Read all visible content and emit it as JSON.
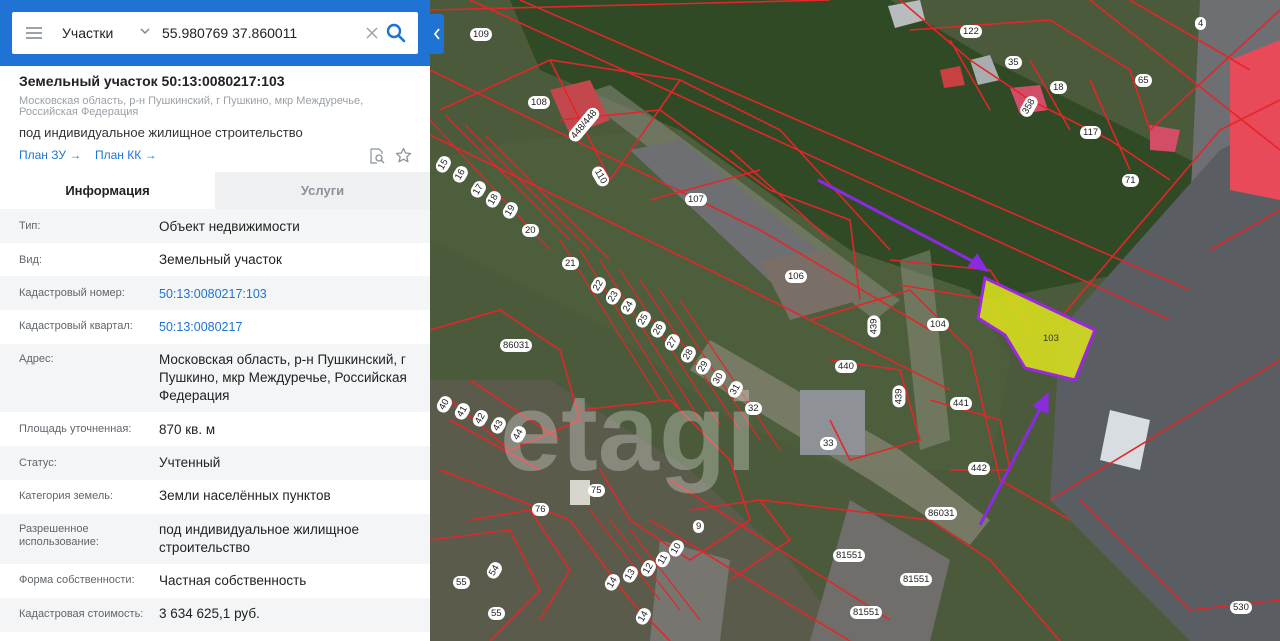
{
  "search": {
    "layer_label": "Участки",
    "query": "55.980769 37.860011"
  },
  "parcel": {
    "title": "Земельный участок 50:13:0080217:103",
    "address": "Московская область, р-н Пушкинский, г Пушкино, мкр Междуречье, Российская Федерация",
    "use": "под индивидуальное жилищное строительство",
    "plan_zu": "План ЗУ →",
    "plan_kk": "План КК →"
  },
  "tabs": {
    "info": "Информация",
    "services": "Услуги"
  },
  "info": [
    {
      "key": "Тип:",
      "value": "Объект недвижимости"
    },
    {
      "key": "Вид:",
      "value": "Земельный участок"
    },
    {
      "key": "Кадастровый номер:",
      "value": "50:13:0080217:103"
    },
    {
      "key": "Кадастровый квартал:",
      "value": "50:13:0080217"
    },
    {
      "key": "Адрес:",
      "value": "Московская область, р-н Пушкинский, г Пушкино, мкр Междуречье, Российская Федерация"
    },
    {
      "key": "Площадь уточненная:",
      "value": "870 кв. м"
    },
    {
      "key": "Статус:",
      "value": "Учтенный"
    },
    {
      "key": "Категория земель:",
      "value": "Земли населённых пунктов"
    },
    {
      "key": "Разрешенное использование:",
      "value": "под индивидуальное жилищное строительство"
    },
    {
      "key": "Форма собственности:",
      "value": "Частная собственность"
    },
    {
      "key": "Кадастровая стоимость:",
      "value": "3 634 625,1 руб."
    }
  ],
  "map": {
    "watermark": "etagi",
    "highlight_label": "103",
    "labels": {
      "l109": "109",
      "l108": "108",
      "l448": "448/448",
      "l110": "110",
      "l107": "107",
      "l106": "106",
      "l122": "122",
      "l35": "35",
      "l18": "18",
      "l358": "358",
      "l65": "65",
      "l117": "117",
      "l71": "71",
      "l4": "4",
      "l15": "15",
      "l16": "16",
      "l17": "17",
      "l18b": "18",
      "l19": "19",
      "l20": "20",
      "l21": "21",
      "l22": "22",
      "l23": "23",
      "l24": "24",
      "l25": "25",
      "l26": "26",
      "l27": "27",
      "l28": "28",
      "l29": "29",
      "l30": "30",
      "l31": "31",
      "l32": "32",
      "l33": "33",
      "l104": "104",
      "l439a": "439",
      "l439b": "439",
      "l440": "440",
      "l441": "441",
      "l442": "442",
      "l86031a": "86031",
      "l86031b": "86031",
      "l81551a": "81551",
      "l81551b": "81551",
      "l81551c": "81551",
      "l40": "40",
      "l41": "41",
      "l42": "42",
      "l43": "43",
      "l44": "44",
      "l76": "76",
      "l75": "75",
      "l9": "9",
      "l10": "10",
      "l11": "11",
      "l12": "12",
      "l13": "13",
      "l14a": "14",
      "l14b": "14",
      "l55a": "55",
      "l54": "54",
      "l55b": "55",
      "l530": "530"
    }
  },
  "colors": {
    "accent": "#1f73d4",
    "boundary": "#e3262a",
    "highlight": "#d9e11e",
    "highlight_border": "#9b27e0",
    "arrow": "#8a2be2"
  }
}
